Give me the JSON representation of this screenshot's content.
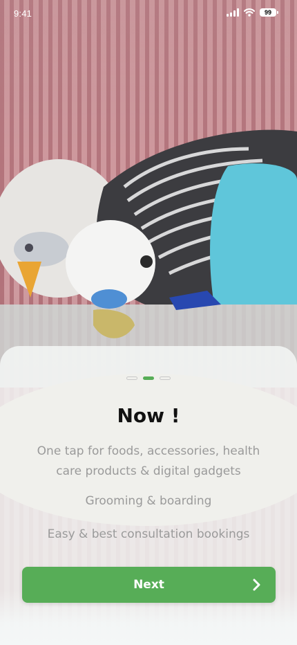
{
  "status_bar": {
    "time": "9:41",
    "battery": "99"
  },
  "hero": {
    "icon": "budgerigar-photo"
  },
  "onboarding": {
    "page_count": 3,
    "active_page": 2,
    "title": "Now !",
    "features": [
      "One tap for foods, accessories, health care products & digital gadgets",
      "Grooming & boarding",
      "Easy & best consultation bookings"
    ],
    "next_label": "Next"
  },
  "colors": {
    "accent": "#57ad57",
    "title": "#111111",
    "body_text": "#9a9a9a"
  }
}
